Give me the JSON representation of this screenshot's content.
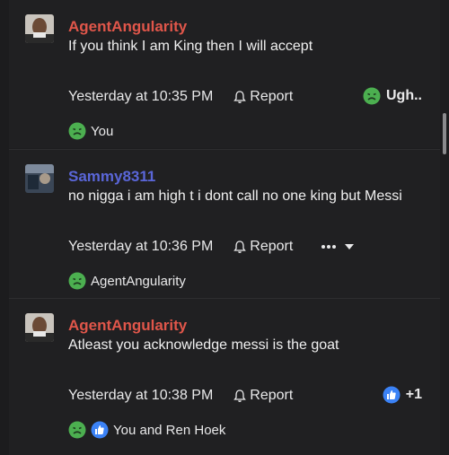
{
  "posts": [
    {
      "username": "AgentAngularity",
      "message": "If you think I am King then I will accept",
      "time": "Yesterday at 10:35 PM",
      "report_label": "Report",
      "reaction_label": "Ugh..",
      "reaction_icon": "sick-face-icon",
      "reacted_by": "You"
    },
    {
      "username": "Sammy8311",
      "message": "no nigga i am high t i dont call no one king but Messi",
      "time": "Yesterday at 10:36 PM",
      "report_label": "Report",
      "reaction_icon": "sick-face-icon",
      "reacted_by": "AgentAngularity"
    },
    {
      "username": "AgentAngularity",
      "message": "Atleast you acknowledge messi is the goat",
      "time": "Yesterday at 10:38 PM",
      "report_label": "Report",
      "reaction_label": "+1",
      "reaction_icon": "thumbs-up-icon",
      "reacted_by": "You and Ren Hoek"
    }
  ],
  "colors": {
    "background": "#1c1c1e",
    "username_red": "#e0564a",
    "username_blue": "#5a66d8",
    "sick_green": "#4caf50",
    "like_blue": "#3b82f6"
  }
}
